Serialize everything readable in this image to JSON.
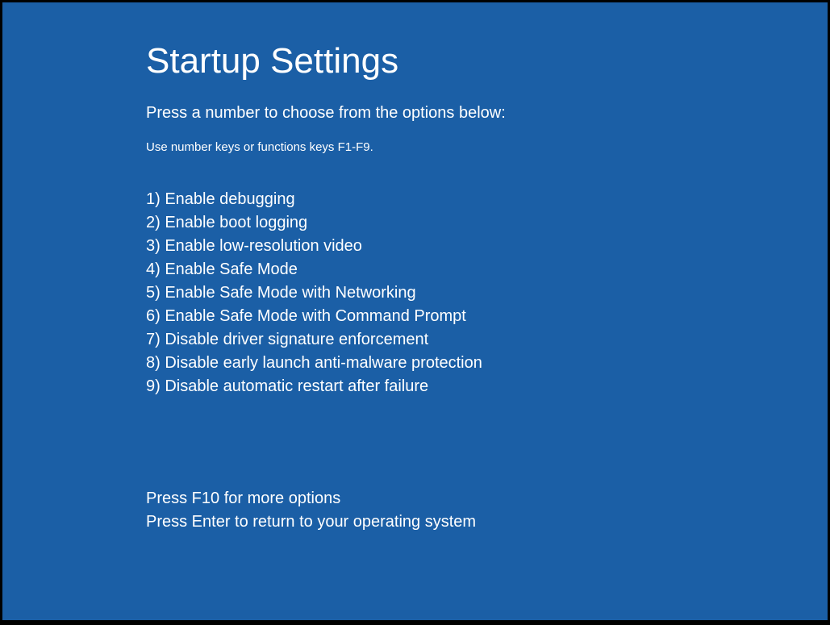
{
  "title": "Startup Settings",
  "instruction": "Press a number to choose from the options below:",
  "hint": "Use number keys or functions keys F1-F9.",
  "options": [
    "1) Enable debugging",
    "2) Enable boot logging",
    "3) Enable low-resolution video",
    "4) Enable Safe Mode",
    "5) Enable Safe Mode with Networking",
    "6) Enable Safe Mode with Command Prompt",
    "7) Disable driver signature enforcement",
    "8) Disable early launch anti-malware protection",
    "9) Disable automatic restart after failure"
  ],
  "footer": {
    "more_options": "Press F10 for more options",
    "return": "Press Enter to return to your operating system"
  }
}
